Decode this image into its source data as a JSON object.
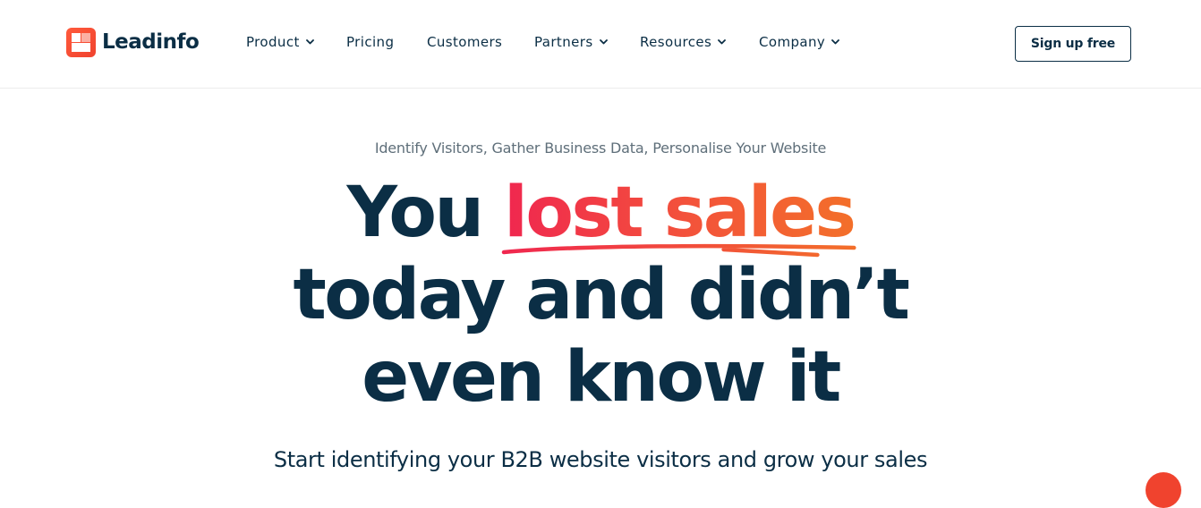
{
  "header": {
    "brand": "Leadinfo",
    "nav": [
      {
        "label": "Product",
        "has_dropdown": true
      },
      {
        "label": "Pricing",
        "has_dropdown": false
      },
      {
        "label": "Customers",
        "has_dropdown": false
      },
      {
        "label": "Partners",
        "has_dropdown": true
      },
      {
        "label": "Resources",
        "has_dropdown": true
      },
      {
        "label": "Company",
        "has_dropdown": true
      }
    ],
    "cta": "Sign up free"
  },
  "hero": {
    "eyebrow": "Identify Visitors, Gather Business Data, Personalise Your Website",
    "headline_pre": "You ",
    "headline_highlight": "lost sales",
    "headline_line2": "today and didn’t",
    "headline_line3": "even know it",
    "subheadline": "Start identifying your B2B website visitors and grow your sales"
  },
  "colors": {
    "navy": "#0b2e45",
    "accent_start": "#f0274f",
    "accent_end": "#f36f2a",
    "brand_orange": "#f0432e"
  },
  "icons": {
    "logo": "leadinfo-logo-icon",
    "dropdown": "chevron-down-icon",
    "chat": "chat-bubble-icon"
  }
}
